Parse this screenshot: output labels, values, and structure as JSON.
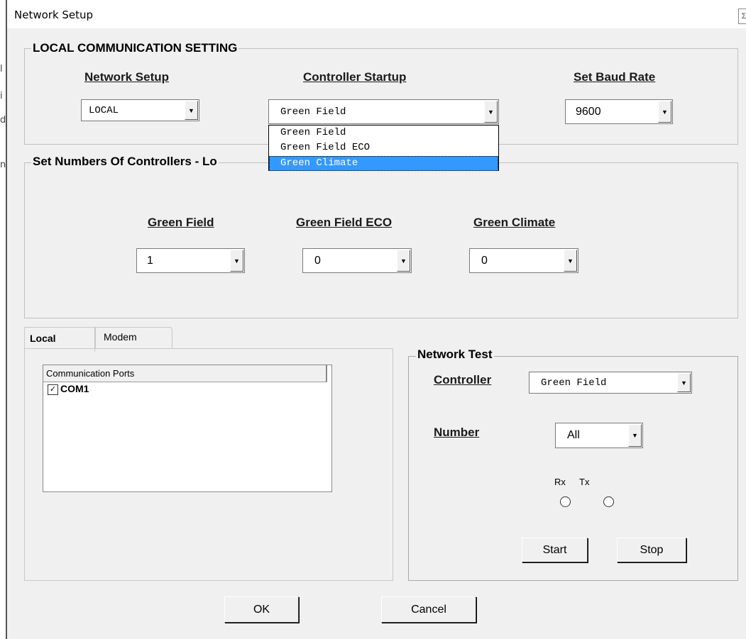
{
  "window": {
    "title": "Network Setup",
    "close_glyph": "Σ"
  },
  "local_comm": {
    "legend": "LOCAL COMMUNICATION SETTING",
    "network_setup": {
      "label": "Network Setup",
      "value": "LOCAL"
    },
    "controller_startup": {
      "label": "Controller Startup",
      "value": "Green Field",
      "options": [
        "Green Field",
        "Green Field ECO",
        "Green Climate"
      ],
      "highlighted": "Green Climate"
    },
    "baud_rate": {
      "label": "Set Baud Rate",
      "value": "9600"
    }
  },
  "controllers": {
    "legend": "Set Numbers Of Controllers - Lo",
    "green_field": {
      "label": "Green Field",
      "value": "1"
    },
    "green_field_eco": {
      "label": "Green Field ECO",
      "value": "0"
    },
    "green_climate": {
      "label": "Green Climate",
      "value": "0"
    }
  },
  "tabs": [
    "Local",
    "Modem"
  ],
  "ports": {
    "header": "Communication Ports",
    "items": [
      {
        "label": "COM1",
        "checked": true,
        "check_glyph": "✓"
      }
    ]
  },
  "network_test": {
    "legend": "Network Test",
    "controller": {
      "label": "Controller",
      "value": "Green Field"
    },
    "number": {
      "label": "Number",
      "value": "All"
    },
    "rx_label": "Rx",
    "tx_label": "Tx",
    "start": "Start",
    "stop": "Stop"
  },
  "footer": {
    "ok": "OK",
    "cancel": "Cancel"
  },
  "left_edge_marks": [
    "l",
    "i",
    "d",
    "n"
  ],
  "colors": {
    "selection": "#3399ff",
    "background": "#f0f0f0",
    "text": "#000000"
  }
}
